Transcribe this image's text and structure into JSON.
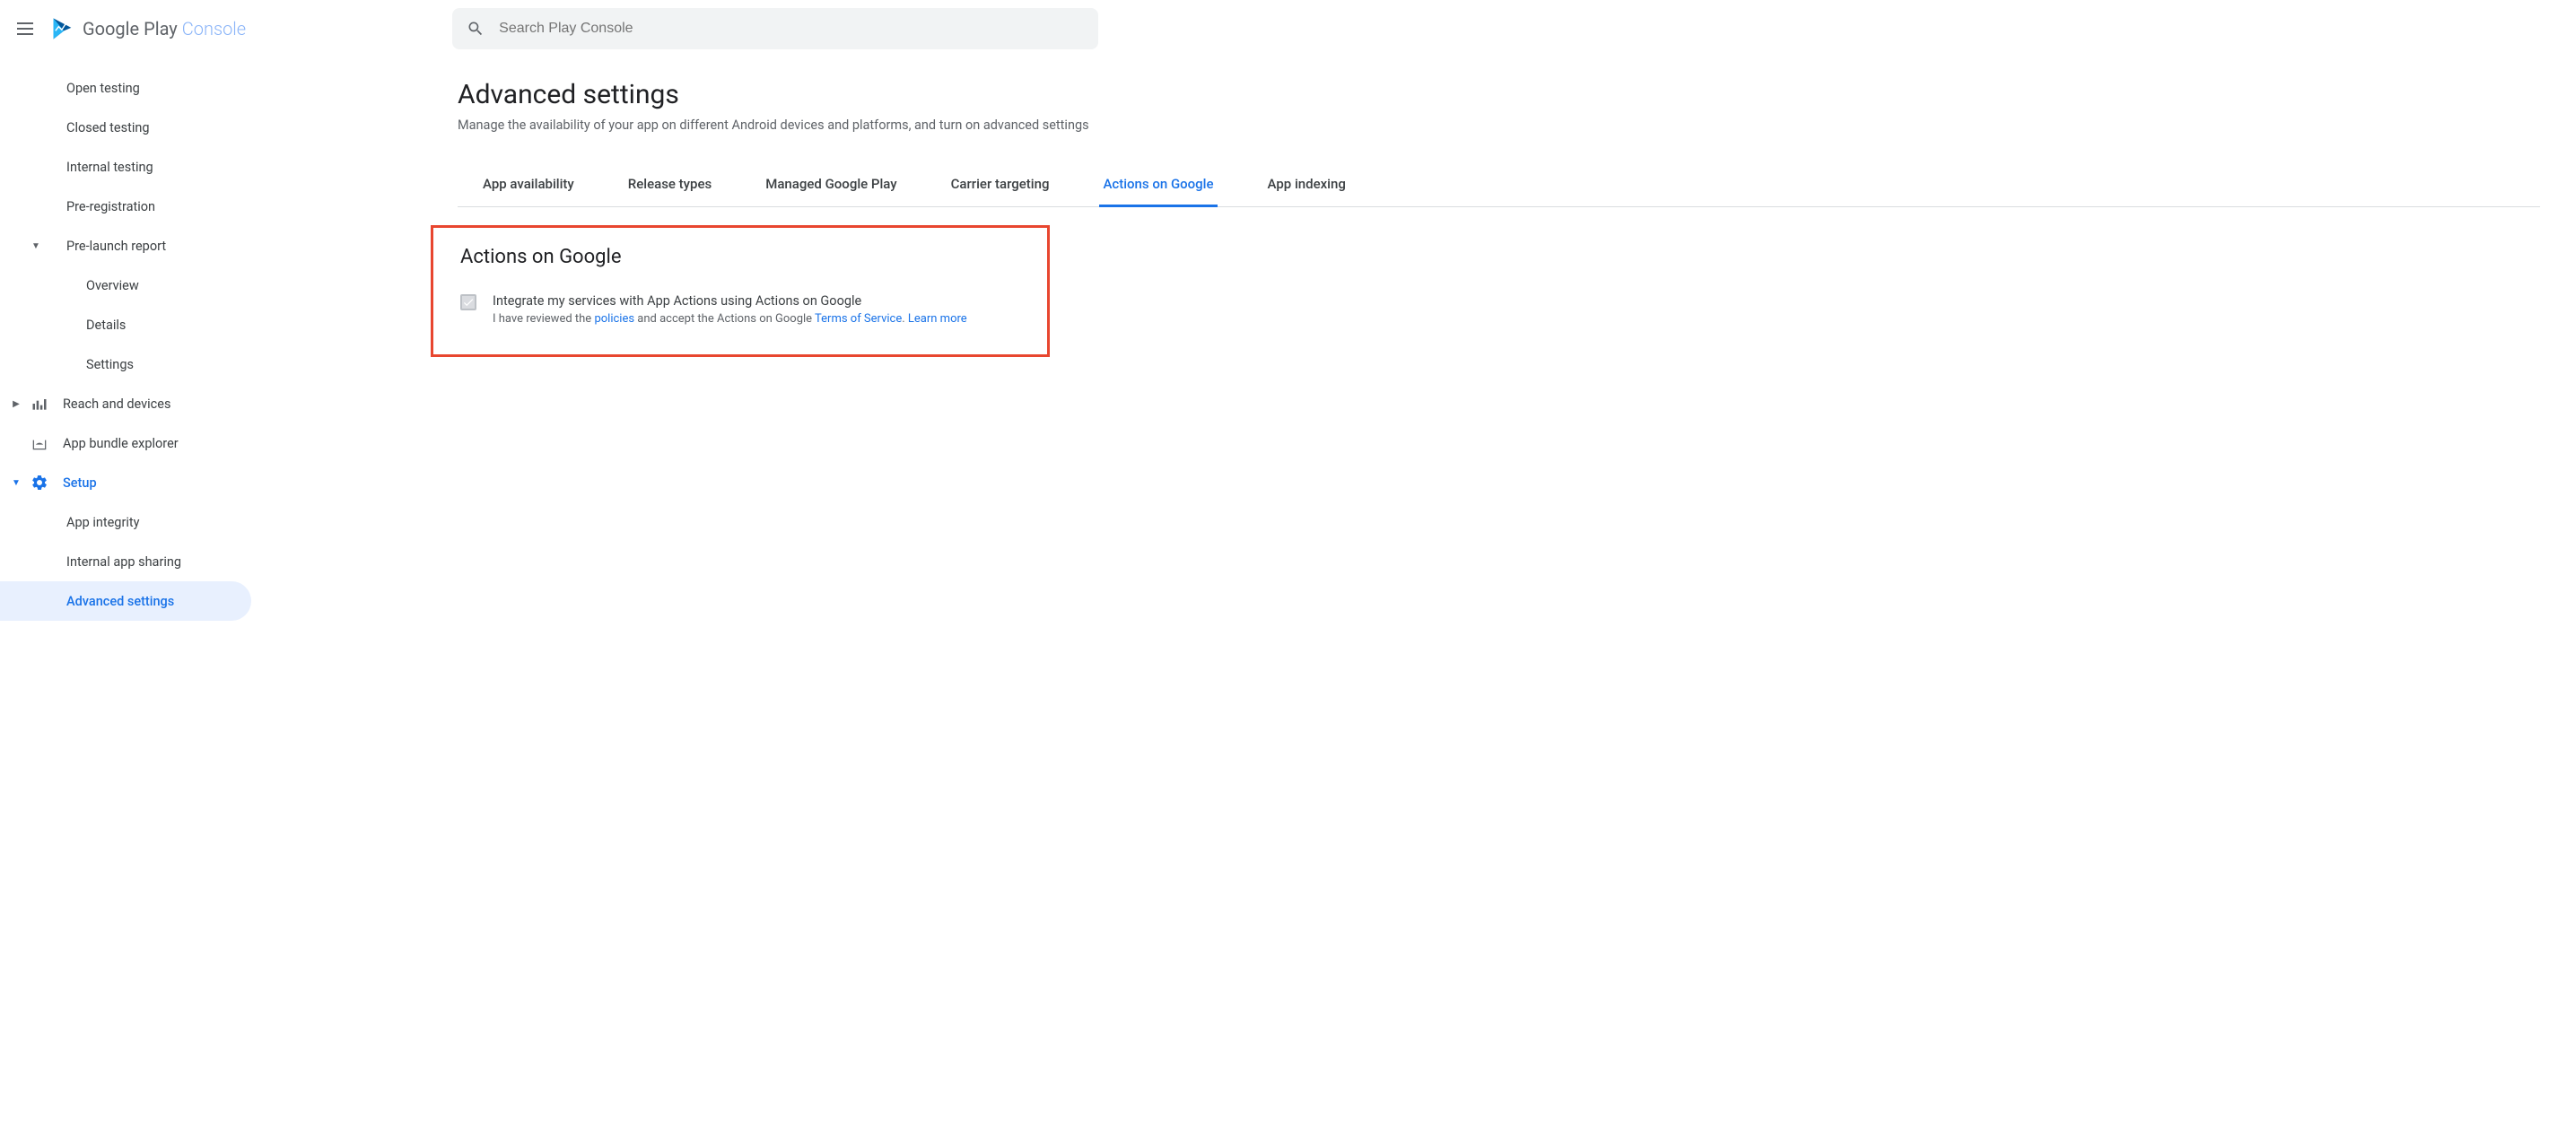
{
  "header": {
    "logo_text_1": "Google Play",
    "logo_text_2": "Console",
    "search_placeholder": "Search Play Console"
  },
  "sidebar": {
    "items": [
      {
        "label": "Open testing",
        "type": "sub"
      },
      {
        "label": "Closed testing",
        "type": "sub"
      },
      {
        "label": "Internal testing",
        "type": "sub"
      },
      {
        "label": "Pre-registration",
        "type": "sub"
      },
      {
        "label": "Pre-launch report",
        "type": "group-open"
      },
      {
        "label": "Overview",
        "type": "sub-deep"
      },
      {
        "label": "Details",
        "type": "sub-deep"
      },
      {
        "label": "Settings",
        "type": "sub-deep"
      },
      {
        "label": "Reach and devices",
        "type": "group-closed",
        "icon": "bars"
      },
      {
        "label": "App bundle explorer",
        "type": "icon-item",
        "icon": "android"
      },
      {
        "label": "Setup",
        "type": "group-open-active",
        "icon": "gear"
      },
      {
        "label": "App integrity",
        "type": "sub"
      },
      {
        "label": "Internal app sharing",
        "type": "sub"
      },
      {
        "label": "Advanced settings",
        "type": "sub-active"
      }
    ]
  },
  "main": {
    "title": "Advanced settings",
    "subtitle": "Manage the availability of your app on different Android devices and platforms, and turn on advanced settings",
    "tabs": [
      {
        "label": "App availability"
      },
      {
        "label": "Release types"
      },
      {
        "label": "Managed Google Play"
      },
      {
        "label": "Carrier targeting"
      },
      {
        "label": "Actions on Google",
        "active": true
      },
      {
        "label": "App indexing"
      }
    ],
    "section": {
      "title": "Actions on Google",
      "checkbox_label": "Integrate my services with App Actions using Actions on Google",
      "sub_pre": "I have reviewed the ",
      "sub_link1": "policies",
      "sub_mid": " and accept the Actions on Google ",
      "sub_link2": "Terms of Service",
      "sub_dot": ". ",
      "sub_link3": "Learn more"
    }
  }
}
